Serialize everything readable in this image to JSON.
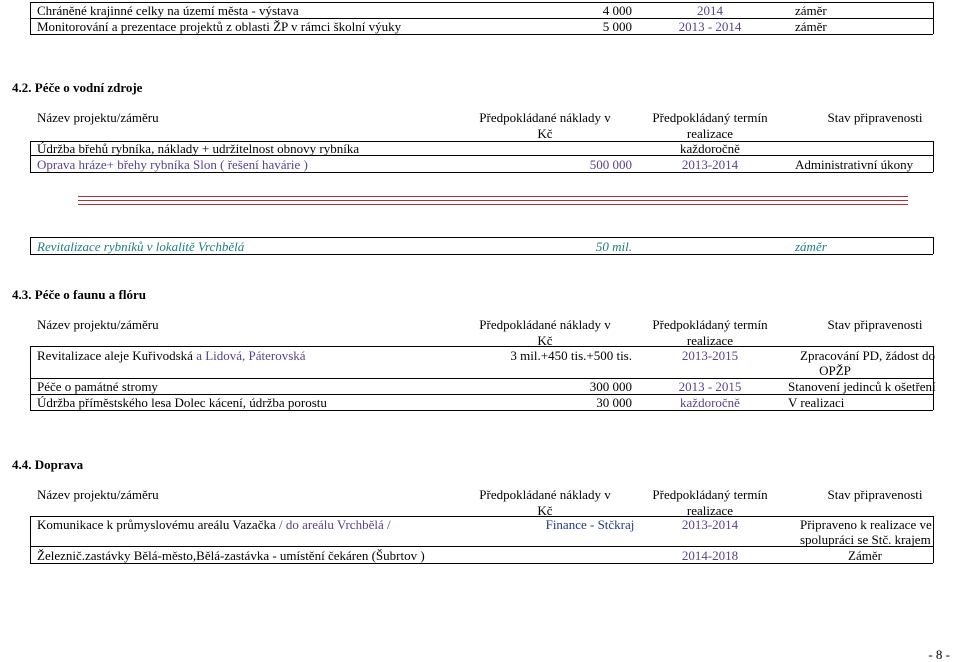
{
  "top_table": {
    "rows": [
      {
        "name": "Chráněné krajinné celky na území města - výstava",
        "cost": "4 000",
        "term": "2014",
        "status": "záměr"
      },
      {
        "name": "Monitorování a prezentace projektů z oblasti ŽP v rámci školní výuky",
        "cost": "5 000",
        "term": "2013 - 2014",
        "status": "záměr"
      }
    ]
  },
  "section_42": {
    "heading": "4.2.  Péče o vodní zdroje",
    "headers": {
      "name": "Název projektu/záměru",
      "cost_1": "Předpokládané náklady v",
      "cost_2": "Kč",
      "term_1": "Předpokládaný termín",
      "term_2": "realizace",
      "status": "Stav připravenosti"
    },
    "rows": [
      {
        "name": "Údržba břehů rybníka, náklady + udržitelnost obnovy rybníka",
        "cost": "",
        "term": "každoročně",
        "status": ""
      },
      {
        "name": "Oprava hráze+ břehy rybníka Slon ( řešení havárie )",
        "cost": "500 000",
        "term": "2013-2014",
        "status": "Administrativní úkony"
      }
    ],
    "extra_row": {
      "name": "Revitalizace rybníků v lokalitě Vrchbělá",
      "cost": "50 mil.",
      "status": "záměr"
    }
  },
  "section_43": {
    "heading": "4.3.  Péče o faunu a flóru",
    "headers": {
      "name": "Název projektu/záměru",
      "cost_1": "Předpokládané náklady v",
      "cost_2": "Kč",
      "term_1": "Předpokládaný termín",
      "term_2": "realizace",
      "status": "Stav připravenosti"
    },
    "rows": [
      {
        "name_a": "Revitalizace aleje Kuřivodská ",
        "name_b": "a Lidová, Páterovská",
        "cost": "3 mil.+450 tis.+500 tis.",
        "term": "2013-2015",
        "status_1": "Zpracování PD, žádost do",
        "status_2": "OPŽP"
      },
      {
        "name": "Péče o památné stromy",
        "cost": "300 000",
        "term": "2013 - 2015",
        "status": "Stanovení jedinců k ošetření"
      },
      {
        "name": "Údržba  příměstského lesa Dolec  kácení, údržba porostu",
        "cost": "30 000",
        "term": "každoročně",
        "status": "V realizaci"
      }
    ]
  },
  "section_44": {
    "heading": "4.4.  Doprava",
    "headers": {
      "name": "Název projektu/záměru",
      "cost_1": "Předpokládané náklady v",
      "cost_2": "Kč",
      "term_1": "Předpokládaný termín",
      "term_2": "realizace",
      "status": "Stav připravenosti"
    },
    "rows": [
      {
        "name_a": "Komunikace k průmyslovému areálu Vazačka ",
        "name_b": "/ do areálu Vrchbělá /",
        "cost": "Finance - Stčkraj",
        "term": "2013-2014",
        "status_1": "Připraveno k realizace ve",
        "status_2": "spolupráci se Stč. krajem"
      },
      {
        "name": "Železnič.zastávky Bělá-město,Bělá-zastávka - umístění čekáren (Šubrtov )",
        "cost": "",
        "term": "2014-2018",
        "status": "Záměr"
      }
    ]
  },
  "footer": {
    "page": "- 8 -"
  }
}
